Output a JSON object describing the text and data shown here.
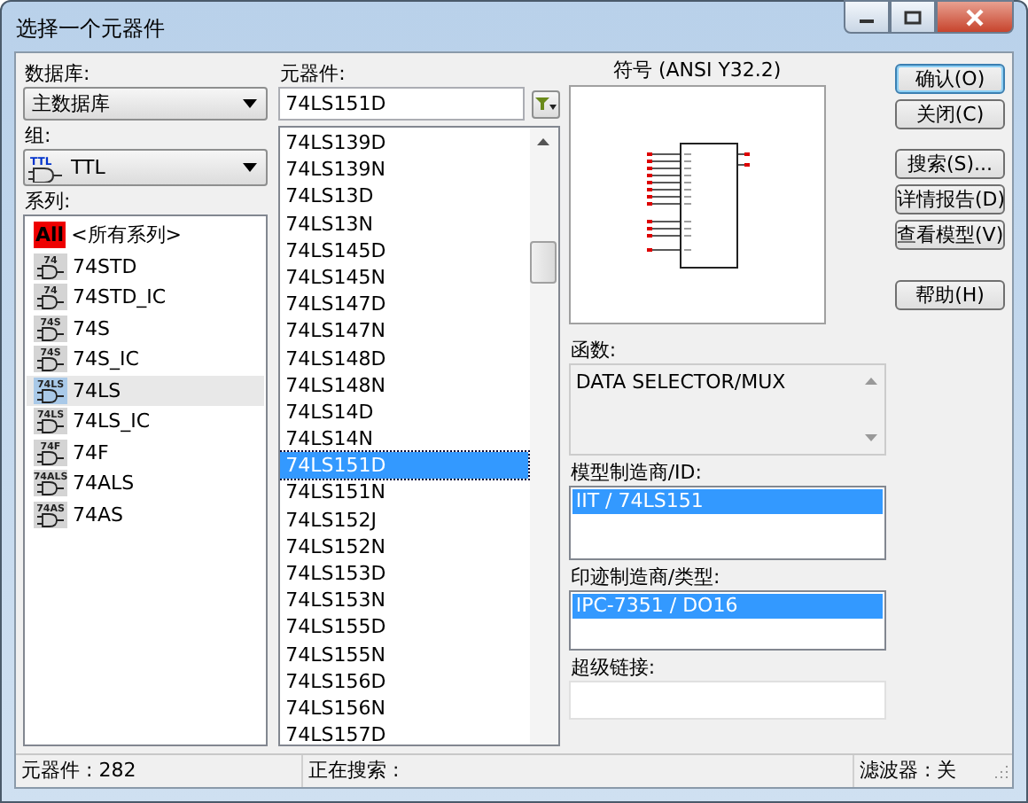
{
  "window": {
    "title": "选择一个元器件"
  },
  "database": {
    "label": "数据库:",
    "value": "主数据库"
  },
  "group": {
    "label": "组:",
    "value": "TTL",
    "badge": "TTL"
  },
  "series": {
    "label": "系列:",
    "items": [
      {
        "label": "<所有系列>",
        "badge": "All",
        "kind": "all",
        "selected": false
      },
      {
        "label": "74STD",
        "badge": "74",
        "kind": "gate",
        "selected": false
      },
      {
        "label": "74STD_IC",
        "badge": "74",
        "kind": "gate",
        "selected": false
      },
      {
        "label": "74S",
        "badge": "74S",
        "kind": "gate",
        "selected": false
      },
      {
        "label": "74S_IC",
        "badge": "74S",
        "kind": "gate",
        "selected": false
      },
      {
        "label": "74LS",
        "badge": "74LS",
        "kind": "gate",
        "selected": true
      },
      {
        "label": "74LS_IC",
        "badge": "74LS",
        "kind": "gate",
        "selected": false
      },
      {
        "label": "74F",
        "badge": "74F",
        "kind": "gate",
        "selected": false
      },
      {
        "label": "74ALS",
        "badge": "74ALS",
        "kind": "gate",
        "selected": false
      },
      {
        "label": "74AS",
        "badge": "74AS",
        "kind": "gate",
        "selected": false
      }
    ]
  },
  "component": {
    "label": "元器件:",
    "value": "74LS151D",
    "items": [
      {
        "label": "74LS139D",
        "selected": false
      },
      {
        "label": "74LS139N",
        "selected": false
      },
      {
        "label": "74LS13D",
        "selected": false
      },
      {
        "label": "74LS13N",
        "selected": false
      },
      {
        "label": "74LS145D",
        "selected": false
      },
      {
        "label": "74LS145N",
        "selected": false
      },
      {
        "label": "74LS147D",
        "selected": false
      },
      {
        "label": "74LS147N",
        "selected": false
      },
      {
        "label": "74LS148D",
        "selected": false
      },
      {
        "label": "74LS148N",
        "selected": false
      },
      {
        "label": "74LS14D",
        "selected": false
      },
      {
        "label": "74LS14N",
        "selected": false
      },
      {
        "label": "74LS151D",
        "selected": true
      },
      {
        "label": "74LS151N",
        "selected": false
      },
      {
        "label": "74LS152J",
        "selected": false
      },
      {
        "label": "74LS152N",
        "selected": false
      },
      {
        "label": "74LS153D",
        "selected": false
      },
      {
        "label": "74LS153N",
        "selected": false
      },
      {
        "label": "74LS155D",
        "selected": false
      },
      {
        "label": "74LS155N",
        "selected": false
      },
      {
        "label": "74LS156D",
        "selected": false
      },
      {
        "label": "74LS156N",
        "selected": false
      },
      {
        "label": "74LS157D",
        "selected": false
      }
    ]
  },
  "symbol": {
    "label": "符号 (ANSI Y32.2)"
  },
  "function": {
    "label": "函数:",
    "value": "DATA SELECTOR/MUX"
  },
  "model_maker": {
    "label": "模型制造商/ID:",
    "items": [
      {
        "label": "IIT / 74LS151",
        "selected": true
      }
    ]
  },
  "footprint": {
    "label": "印迹制造商/类型:",
    "items": [
      {
        "label": "IPC-7351 / DO16",
        "selected": true
      }
    ]
  },
  "hyperlink": {
    "label": "超级链接:"
  },
  "buttons": [
    {
      "label": "确认(O)",
      "default": true
    },
    {
      "label": "关闭(C)",
      "default": false
    },
    {
      "label": "搜索(S)...",
      "default": false
    },
    {
      "label": "详情报告(D)",
      "default": false
    },
    {
      "label": "查看模型(V)",
      "default": false
    },
    {
      "label": "帮助(H)",
      "default": false
    }
  ],
  "status_bar": [
    "元器件 : 282",
    "正在搜索 :",
    "滤波器 : 关"
  ]
}
